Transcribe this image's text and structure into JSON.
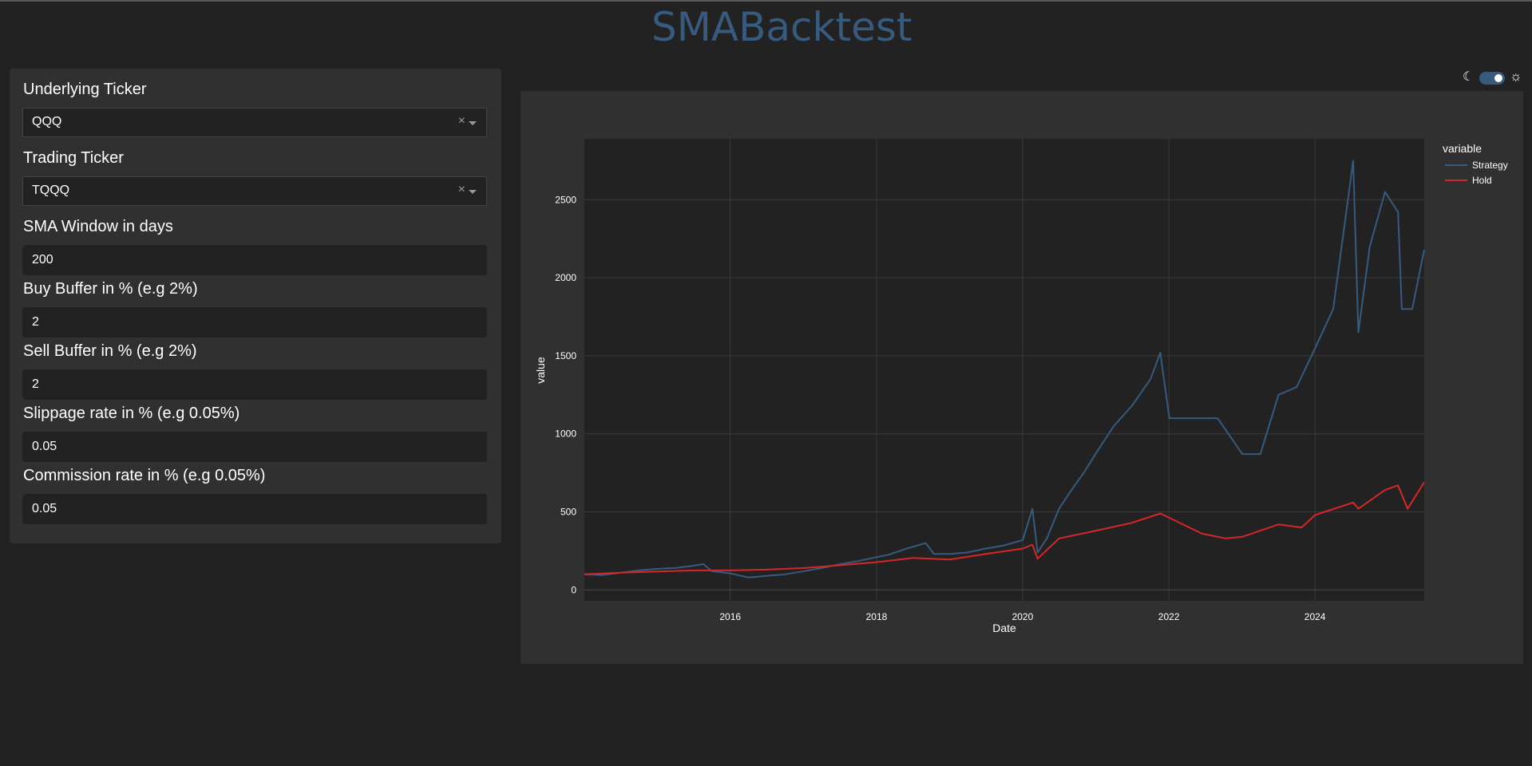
{
  "app": {
    "title": "SMABacktest"
  },
  "theme_toggle": {
    "dark_icon": "moon-icon",
    "light_icon": "sun-icon",
    "state": "dark"
  },
  "form": {
    "underlying_ticker": {
      "label": "Underlying Ticker",
      "value": "QQQ"
    },
    "trading_ticker": {
      "label": "Trading Ticker",
      "value": "TQQQ"
    },
    "sma_window": {
      "label": "SMA Window in days",
      "value": "200"
    },
    "buy_buffer": {
      "label": "Buy Buffer in % (e.g 2%)",
      "value": "2"
    },
    "sell_buffer": {
      "label": "Sell Buffer in % (e.g 2%)",
      "value": "2"
    },
    "slippage": {
      "label": "Slippage rate in % (e.g 0.05%)",
      "value": "0.05"
    },
    "commission": {
      "label": "Commission rate in % (e.g 0.05%)",
      "value": "0.05"
    }
  },
  "colors": {
    "accent": "#375a7f",
    "strategy_line": "#375a7f",
    "hold_line": "#d62728",
    "plot_bg": "#222222",
    "paper_bg": "#303030"
  },
  "chart_data": {
    "type": "line",
    "xlabel": "Date",
    "ylabel": "value",
    "legend_title": "variable",
    "legend_placement": "top-right",
    "grid": true,
    "xlim": [
      "2014-01-02",
      "2025-06-30"
    ],
    "ylim": [
      -70,
      2890
    ],
    "x_ticks": [
      "2016",
      "2018",
      "2020",
      "2022",
      "2024"
    ],
    "y_ticks": [
      0,
      500,
      1000,
      1500,
      2000,
      2500
    ],
    "series": [
      {
        "name": "Strategy",
        "color": "#375a7f",
        "x": [
          "2014-01-02",
          "2014-04-01",
          "2014-07-01",
          "2014-10-01",
          "2015-01-02",
          "2015-04-01",
          "2015-07-01",
          "2015-08-20",
          "2015-10-01",
          "2016-01-04",
          "2016-04-01",
          "2016-07-01",
          "2016-10-03",
          "2017-01-03",
          "2017-04-03",
          "2017-07-03",
          "2017-10-02",
          "2018-01-02",
          "2018-03-01",
          "2018-06-01",
          "2018-09-04",
          "2018-10-15",
          "2019-01-02",
          "2019-04-01",
          "2019-07-01",
          "2019-10-01",
          "2020-01-02",
          "2020-02-19",
          "2020-03-16",
          "2020-05-01",
          "2020-07-01",
          "2020-09-01",
          "2020-11-02",
          "2021-01-04",
          "2021-04-01",
          "2021-07-01",
          "2021-10-01",
          "2021-11-19",
          "2022-01-03",
          "2022-03-01",
          "2022-09-01",
          "2023-01-03",
          "2023-04-03",
          "2023-07-03",
          "2023-10-02",
          "2024-01-02",
          "2024-04-01",
          "2024-07-10",
          "2024-08-05",
          "2024-10-01",
          "2024-12-16",
          "2025-02-19",
          "2025-03-10",
          "2025-05-01",
          "2025-06-30"
        ],
        "values": [
          100,
          95,
          110,
          125,
          135,
          140,
          155,
          165,
          120,
          105,
          80,
          90,
          100,
          120,
          140,
          165,
          185,
          210,
          225,
          265,
          300,
          230,
          230,
          240,
          265,
          285,
          320,
          520,
          240,
          330,
          520,
          640,
          750,
          880,
          1050,
          1180,
          1350,
          1520,
          1100,
          1100,
          1100,
          870,
          870,
          1250,
          1300,
          1550,
          1800,
          2750,
          1650,
          2200,
          2550,
          2420,
          1800,
          1800,
          2180
        ]
      },
      {
        "name": "Hold",
        "color": "#d62728",
        "x": [
          "2014-01-02",
          "2014-07-01",
          "2015-01-02",
          "2015-07-01",
          "2016-01-04",
          "2016-07-01",
          "2017-01-03",
          "2017-07-03",
          "2018-01-02",
          "2018-07-02",
          "2019-01-02",
          "2019-07-01",
          "2020-01-02",
          "2020-02-19",
          "2020-03-16",
          "2020-07-01",
          "2021-01-04",
          "2021-07-01",
          "2021-11-19",
          "2022-06-16",
          "2022-10-13",
          "2023-01-03",
          "2023-07-03",
          "2023-10-26",
          "2024-01-02",
          "2024-07-10",
          "2024-08-05",
          "2024-12-16",
          "2025-02-19",
          "2025-04-08",
          "2025-06-30"
        ],
        "values": [
          100,
          110,
          118,
          125,
          125,
          130,
          140,
          158,
          178,
          205,
          195,
          230,
          265,
          290,
          200,
          330,
          380,
          430,
          490,
          360,
          330,
          340,
          420,
          400,
          480,
          560,
          520,
          640,
          670,
          520,
          690
        ]
      }
    ]
  }
}
